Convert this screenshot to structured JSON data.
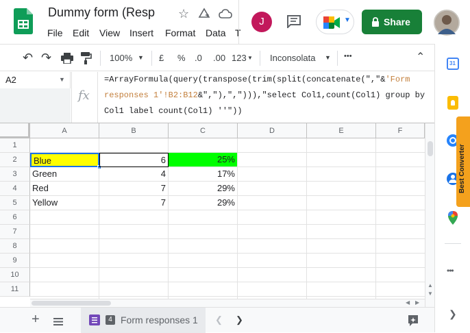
{
  "app": {
    "doc_title": "Dummy form (Resp",
    "menu": [
      "File",
      "Edit",
      "View",
      "Insert",
      "Format",
      "Data",
      "T"
    ],
    "share_label": "Share",
    "avatar_letter": "J"
  },
  "toolbar": {
    "zoom": "100%",
    "currency": "£",
    "percent": "%",
    "dec_decrease": ".0",
    "dec_increase": ".00",
    "more_formats": "123",
    "font": "Inconsolata",
    "more": "•••"
  },
  "formula_bar": {
    "cell_ref": "A2",
    "fx": "fx",
    "line1_a": "=ArrayFormula(query(transpose(trim(split(concatenate(\",\"&",
    "line1_b": "'Form",
    "line2_a": "responses 1'!B2:B12",
    "line2_b": "&\",\"),\",\"))),\"select Col1,count(Col1) group by",
    "line3": "Col1 label count(Col1) ''\"))"
  },
  "grid": {
    "columns": [
      "A",
      "B",
      "C",
      "D",
      "E",
      "F"
    ],
    "rows": [
      "1",
      "2",
      "3",
      "4",
      "5",
      "6",
      "7",
      "8",
      "9",
      "10",
      "11"
    ],
    "data": [
      {
        "color": "Blue",
        "count": "6",
        "pct": "25%"
      },
      {
        "color": "Green",
        "count": "4",
        "pct": "17%"
      },
      {
        "color": "Red",
        "count": "7",
        "pct": "29%"
      },
      {
        "color": "Yellow",
        "count": "7",
        "pct": "29%"
      }
    ]
  },
  "sheet_tab": {
    "badge": "4",
    "label": "Form responses 1"
  },
  "extension": {
    "label": "Best Converter"
  },
  "colors": {
    "share_green": "#188038",
    "highlight_yellow": "#ffff00",
    "highlight_green": "#00ff00",
    "selection_blue": "#1a73e8"
  }
}
